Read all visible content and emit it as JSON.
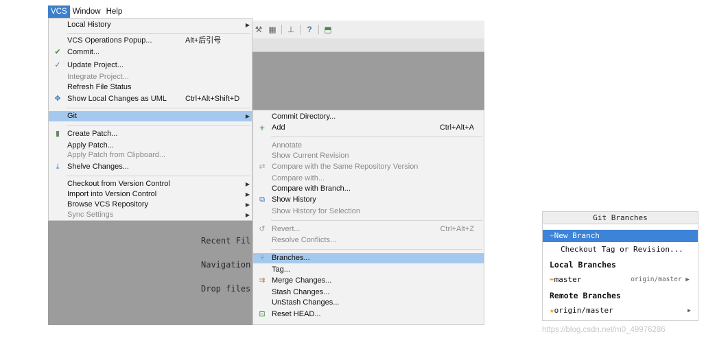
{
  "menubar": {
    "vcs": "VCS",
    "window": "Window",
    "help": "Help"
  },
  "toolbar": {
    "icons": [
      "wrench-icon",
      "structure-icon",
      "sdk-icon",
      "help-icon",
      "vcs-icon"
    ],
    "help_glyph": "?"
  },
  "editor_hints": {
    "recent_files": "Recent Fil",
    "navigation": "Navigation",
    "drop_files": "Drop files"
  },
  "vcs_menu": {
    "local_history": "Local History",
    "vcs_operations_popup": "VCS Operations Popup...",
    "vcs_operations_shortcut": "Alt+后引号",
    "commit": "Commit...",
    "update_project": "Update Project...",
    "integrate_project": "Integrate Project...",
    "refresh_file_status": "Refresh File Status",
    "show_local_changes_uml": "Show Local Changes as UML",
    "show_local_changes_shortcut": "Ctrl+Alt+Shift+D",
    "git": "Git",
    "create_patch": "Create Patch...",
    "apply_patch": "Apply Patch...",
    "apply_patch_clipboard": "Apply Patch from Clipboard...",
    "shelve_changes": "Shelve Changes...",
    "checkout_vc": "Checkout from Version Control",
    "import_vc": "Import into Version Control",
    "browse_vcs": "Browse VCS Repository",
    "sync_settings": "Sync Settings"
  },
  "git_menu": {
    "commit_directory": "Commit Directory...",
    "add": "Add",
    "add_shortcut": "Ctrl+Alt+A",
    "annotate": "Annotate",
    "show_current_revision": "Show Current Revision",
    "compare_same_repo": "Compare with the Same Repository Version",
    "compare_with": "Compare with...",
    "compare_with_branch": "Compare with Branch...",
    "show_history": "Show History",
    "show_history_selection": "Show History for Selection",
    "revert": "Revert...",
    "revert_shortcut": "Ctrl+Alt+Z",
    "resolve_conflicts": "Resolve Conflicts...",
    "branches": "Branches...",
    "tag": "Tag...",
    "merge_changes": "Merge Changes...",
    "stash_changes": "Stash Changes...",
    "unstash_changes": "UnStash Changes...",
    "reset_head": "Reset HEAD..."
  },
  "git_branches": {
    "title": "Git Branches",
    "new_branch": "New Branch",
    "checkout_tag": "Checkout Tag or Revision...",
    "local_header": "Local Branches",
    "local_master": "master",
    "local_master_tracking": "origin/master",
    "remote_header": "Remote Branches",
    "remote_master": "origin/master"
  },
  "watermark": "https://blog.csdn.net/m0_49976286",
  "colors": {
    "menubar_active": "#3d80c9",
    "menu_selected": "#a5c9ee",
    "popup_selected": "#3d84d9",
    "editor_bg": "#9c9c9c"
  }
}
